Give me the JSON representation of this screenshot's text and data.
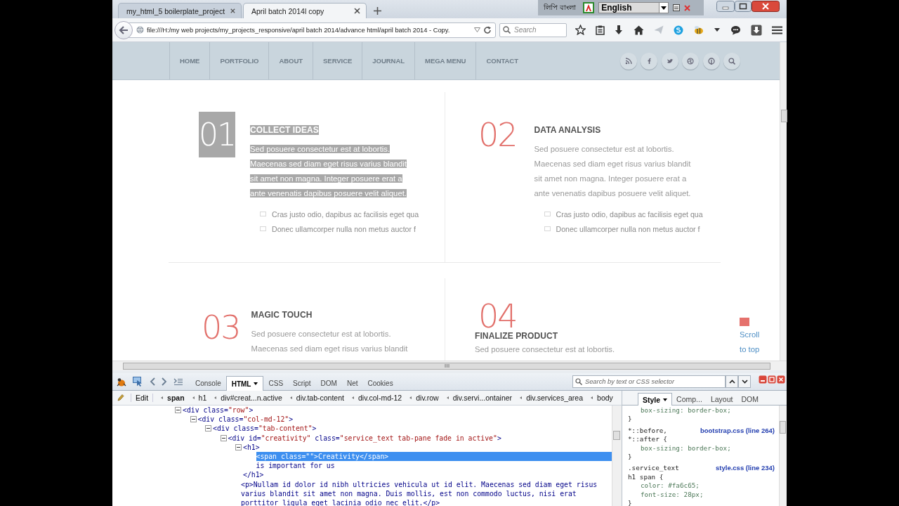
{
  "browser": {
    "tabs": [
      {
        "label": "my_html_5 boilerplate_project",
        "selected": false
      },
      {
        "label": "April batch 2014l copy",
        "selected": true
      }
    ],
    "language_bar": {
      "script": "লিপি বাংলা",
      "language": "English"
    },
    "address": "file:///H:/my web projects/my_projects_responsive/april batch 2014/advance html/april batch 2014 - Copy.",
    "search_placeholder": "Search"
  },
  "site": {
    "nav": [
      "HOME",
      "PORTFOLIO",
      "ABOUT",
      "SERVICE",
      "JOURNAL",
      "MEGA MENU",
      "CONTACT"
    ],
    "services": [
      {
        "number": "01",
        "title": "COLLECT IDEAS",
        "kind": "side",
        "highlighted": true,
        "lines": [
          "Sed posuere consectetur est at lobortis.",
          "Maecenas sed diam eget risus varius blandit",
          "sit amet non magna. Integer posuere erat a",
          "ante venenatis dapibus posuere velit aliquet."
        ],
        "list": [
          "Cras justo odio, dapibus ac facilisis eget qua",
          "Donec ullamcorper nulla non metus auctor f"
        ]
      },
      {
        "number": "02",
        "title": "DATA ANALYSIS",
        "kind": "side",
        "highlighted": false,
        "lines": [
          "Sed posuere consectetur est at lobortis.",
          "Maecenas sed diam eget risus varius blandit",
          "sit amet non magna. Integer posuere erat a",
          "ante venenatis dapibus posuere velit aliquet."
        ],
        "list": [
          "Cras justo odio, dapibus ac facilisis eget qua",
          "Donec ullamcorper nulla non metus auctor f"
        ]
      },
      {
        "number": "03",
        "title": "MAGIC TOUCH",
        "kind": "side",
        "highlighted": false,
        "lines": [
          "Sed posuere consectetur est at lobortis.",
          "Maecenas sed diam eget risus varius blandit"
        ]
      },
      {
        "number": "04",
        "title": "FINALIZE PRODUCT",
        "kind": "stacked",
        "highlighted": false,
        "lines": [
          "Sed posuere consectetur est at lobortis."
        ]
      }
    ],
    "scroll_to_top": "Scroll to top"
  },
  "devtools": {
    "panels": [
      {
        "label": "Console",
        "selected": false,
        "menu": false
      },
      {
        "label": "HTML",
        "selected": true,
        "menu": true
      },
      {
        "label": "CSS",
        "selected": false,
        "menu": false
      },
      {
        "label": "Script",
        "selected": false,
        "menu": false
      },
      {
        "label": "DOM",
        "selected": false,
        "menu": false
      },
      {
        "label": "Net",
        "selected": false,
        "menu": false
      },
      {
        "label": "Cookies",
        "selected": false,
        "menu": false
      }
    ],
    "search_placeholder": "Search by text or CSS selector",
    "edit": "Edit",
    "breadcrumbs": [
      {
        "label": "span",
        "selected": true
      },
      {
        "label": "h1",
        "selected": false
      },
      {
        "label": "div#creat...n.active",
        "selected": false
      },
      {
        "label": "div.tab-content",
        "selected": false
      },
      {
        "label": "div.col-md-12",
        "selected": false
      },
      {
        "label": "div.row",
        "selected": false
      },
      {
        "label": "div.servi...ontainer",
        "selected": false
      },
      {
        "label": "div.services_area",
        "selected": false
      },
      {
        "label": "body",
        "selected": false
      }
    ],
    "side_tabs": [
      {
        "label": "Style",
        "selected": true,
        "menu": true
      },
      {
        "label": "Comp...",
        "selected": false,
        "menu": false
      },
      {
        "label": "Layout",
        "selected": false,
        "menu": false
      },
      {
        "label": "DOM",
        "selected": false,
        "menu": false
      }
    ],
    "tree": [
      {
        "kind": "element",
        "text": "<div class=\"row\">",
        "expanded": true,
        "selected": false,
        "children": [
          {
            "kind": "element",
            "text": "<div class=\"col-md-12\">",
            "expanded": true,
            "selected": false,
            "children": [
              {
                "kind": "element",
                "text": "<div class=\"tab-content\">",
                "expanded": true,
                "selected": false,
                "children": [
                  {
                    "kind": "element",
                    "text": "<div id=\"creativity\" class=\"service_text tab-pane fade in active\">",
                    "expanded": true,
                    "selected": false,
                    "children": [
                      {
                        "kind": "element",
                        "text": "<h1>",
                        "expanded": true,
                        "selected": false,
                        "close": "</h1>",
                        "children": [
                          {
                            "kind": "text",
                            "text": "<span class=\"\">Creativity</span>",
                            "selected": true
                          },
                          {
                            "kind": "text",
                            "text": "is important for us",
                            "selected": false
                          }
                        ]
                      },
                      {
                        "kind": "text",
                        "text": "<p>Nullam id dolor id nibh ultricies vehicula ut id elit. Maecenas sed diam eget risus varius blandit sit amet non magna. Duis mollis, est non commodo luctus, nisi erat porttitor ligula eget lacinia odio nec elit.</p>",
                        "selected": false
                      }
                    ]
                  }
                ]
              }
            ]
          }
        ]
      }
    ],
    "style_rules": [
      {
        "declarations": [
          "box-sizing: border-box;"
        ],
        "close": "}"
      },
      {
        "selector": [
          "*::before,",
          "*::after {"
        ],
        "source": "bootstrap.css (line 264)",
        "declarations": [
          "box-sizing: border-box;"
        ],
        "close": "}"
      },
      {
        "selector": [
          ".service_text",
          "h1 span {"
        ],
        "source": "style.css (line 234)",
        "declarations": [
          "color: #fa6c65;",
          "font-size: 28px;"
        ],
        "close": "}"
      }
    ]
  }
}
